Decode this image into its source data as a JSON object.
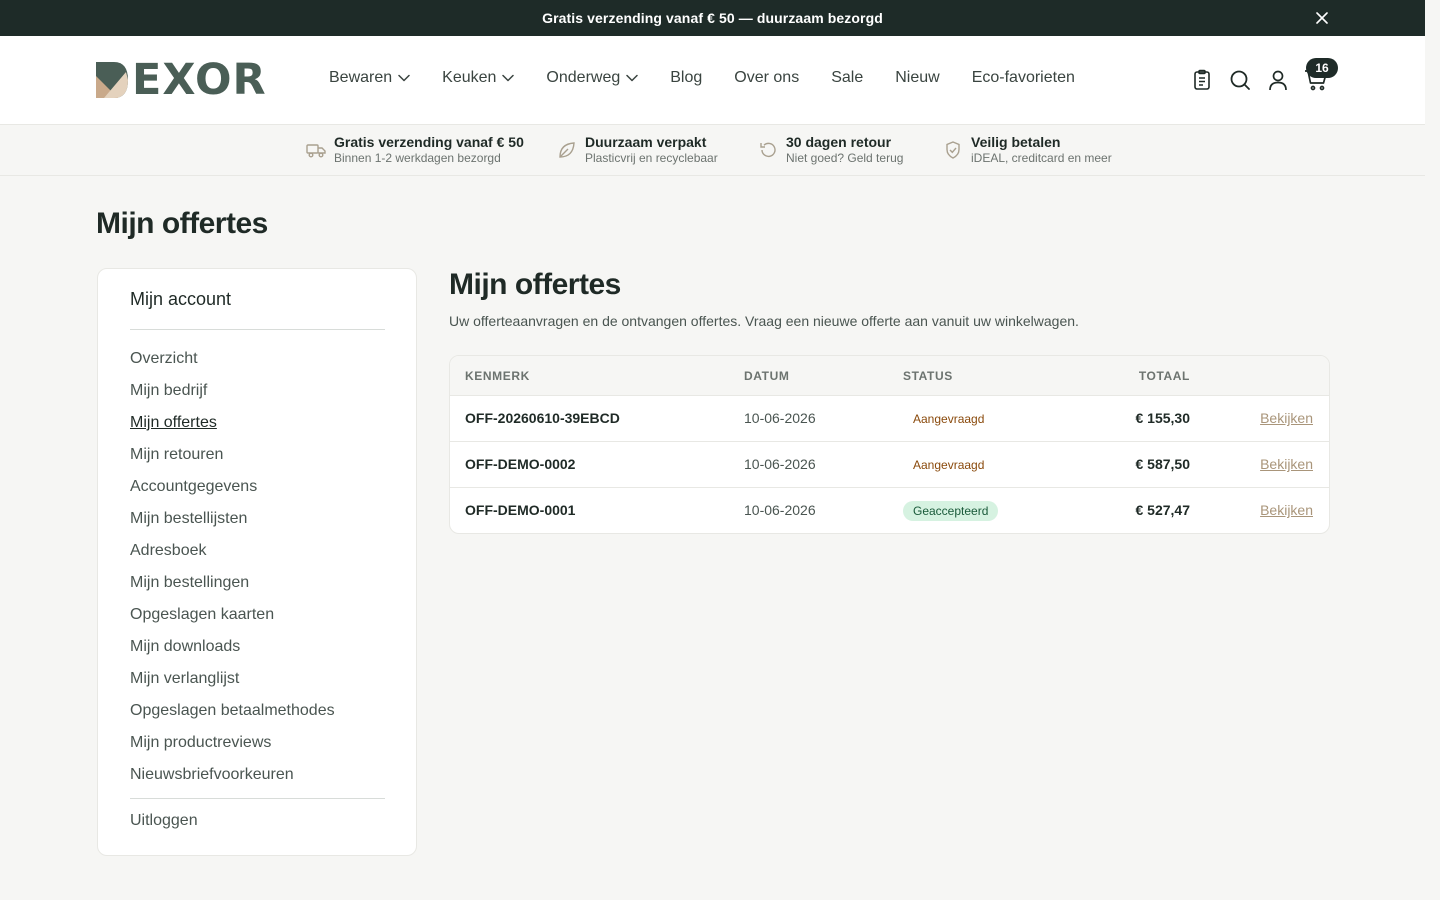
{
  "announcement": {
    "text": "Gratis verzending vanaf € 50 — duurzaam bezorgd"
  },
  "header": {
    "logo_text": "EXOR",
    "nav": [
      {
        "label": "Bewaren",
        "dropdown": true
      },
      {
        "label": "Keuken",
        "dropdown": true
      },
      {
        "label": "Onderweg",
        "dropdown": true
      },
      {
        "label": "Blog",
        "dropdown": false
      },
      {
        "label": "Over ons",
        "dropdown": false
      },
      {
        "label": "Sale",
        "dropdown": false
      },
      {
        "label": "Nieuw",
        "dropdown": false
      },
      {
        "label": "Eco-favorieten",
        "dropdown": false
      }
    ],
    "icons": [
      "clipboard-icon",
      "search-icon",
      "user-icon",
      "cart-icon"
    ],
    "cart_count": "16"
  },
  "usps": [
    {
      "icon": "truck-icon",
      "title": "Gratis verzending vanaf € 50",
      "sub": "Binnen 1-2 werkdagen bezorgd"
    },
    {
      "icon": "leaf-icon",
      "title": "Duurzaam verpakt",
      "sub": "Plasticvrij en recyclebaar"
    },
    {
      "icon": "return-icon",
      "title": "30 dagen retour",
      "sub": "Niet goed? Geld terug"
    },
    {
      "icon": "shield-icon",
      "title": "Veilig betalen",
      "sub": "iDEAL, creditcard en meer"
    }
  ],
  "page_title": "Mijn offertes",
  "sidebar": {
    "title": "Mijn account",
    "items": [
      "Overzicht",
      "Mijn bedrijf",
      "Mijn offertes",
      "Mijn retouren",
      "Accountgegevens",
      "Mijn bestellijsten",
      "Adresboek",
      "Mijn bestellingen",
      "Opgeslagen kaarten",
      "Mijn downloads",
      "Mijn verlanglijst",
      "Opgeslagen betaalmethodes",
      "Mijn productreviews",
      "Nieuwsbriefvoorkeuren"
    ],
    "active_index": 2,
    "logout": "Uitloggen"
  },
  "content": {
    "title": "Mijn offertes",
    "intro": "Uw offerteaanvragen en de ontvangen offertes. Vraag een nieuwe offerte aan vanuit uw winkelwagen.",
    "columns": {
      "ref": "KENMERK",
      "date": "DATUM",
      "status": "STATUS",
      "total": "TOTAAL"
    },
    "rows": [
      {
        "ref": "OFF-20260610-39EBCD",
        "date": "10-06-2026",
        "status": "Aangevraagd",
        "status_type": "requested",
        "total": "€ 155,30",
        "action": "Bekijken"
      },
      {
        "ref": "OFF-DEMO-0002",
        "date": "10-06-2026",
        "status": "Aangevraagd",
        "status_type": "requested",
        "total": "€ 587,50",
        "action": "Bekijken"
      },
      {
        "ref": "OFF-DEMO-0001",
        "date": "10-06-2026",
        "status": "Geaccepteerd",
        "status_type": "accepted",
        "total": "€ 527,47",
        "action": "Bekijken"
      }
    ]
  },
  "colors": {
    "dark": "#1e2b28",
    "accent": "#a9957a",
    "accepted_bg": "#d6f2e1",
    "requested_text": "#8a4a0c"
  }
}
